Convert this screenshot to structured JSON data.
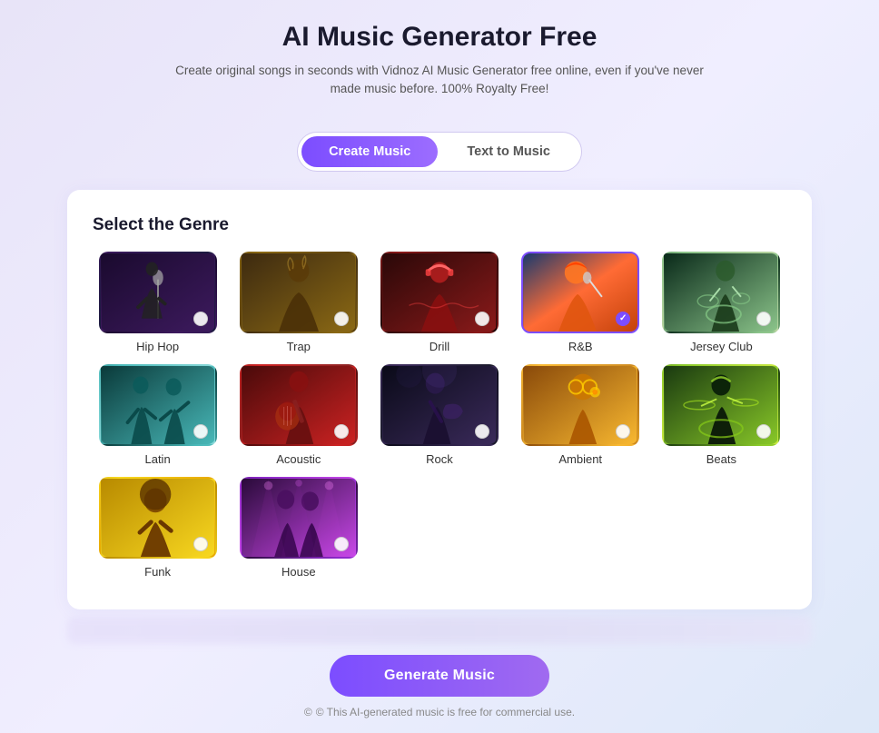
{
  "header": {
    "title": "AI Music Generator Free",
    "subtitle": "Create original songs in seconds with Vidnoz AI Music Generator free online, even if you've never made music before. 100% Royalty Free!"
  },
  "tabs": [
    {
      "id": "create",
      "label": "Create Music",
      "active": true
    },
    {
      "id": "text",
      "label": "Text to Music",
      "active": false
    }
  ],
  "section": {
    "title": "Select the Genre"
  },
  "genres": [
    {
      "id": "hiphop",
      "label": "Hip Hop",
      "colorClass": "genre-hiphop",
      "selected": false
    },
    {
      "id": "trap",
      "label": "Trap",
      "colorClass": "genre-trap",
      "selected": false
    },
    {
      "id": "drill",
      "label": "Drill",
      "colorClass": "genre-drill",
      "selected": false
    },
    {
      "id": "rnb",
      "label": "R&B",
      "colorClass": "genre-rnb",
      "selected": true
    },
    {
      "id": "jerseyclub",
      "label": "Jersey Club",
      "colorClass": "genre-jerseyclub",
      "selected": false
    },
    {
      "id": "latin",
      "label": "Latin",
      "colorClass": "genre-latin",
      "selected": false
    },
    {
      "id": "acoustic",
      "label": "Acoustic",
      "colorClass": "genre-acoustic",
      "selected": false
    },
    {
      "id": "rock",
      "label": "Rock",
      "colorClass": "genre-rock",
      "selected": false
    },
    {
      "id": "ambient",
      "label": "Ambient",
      "colorClass": "genre-ambient",
      "selected": false
    },
    {
      "id": "beats",
      "label": "Beats",
      "colorClass": "genre-beats",
      "selected": false
    },
    {
      "id": "funk",
      "label": "Funk",
      "colorClass": "genre-funk",
      "selected": false
    },
    {
      "id": "house",
      "label": "House",
      "colorClass": "genre-house",
      "selected": false
    }
  ],
  "generate_btn": "Generate Music",
  "copyright": "© This AI-generated music is free for commercial use."
}
